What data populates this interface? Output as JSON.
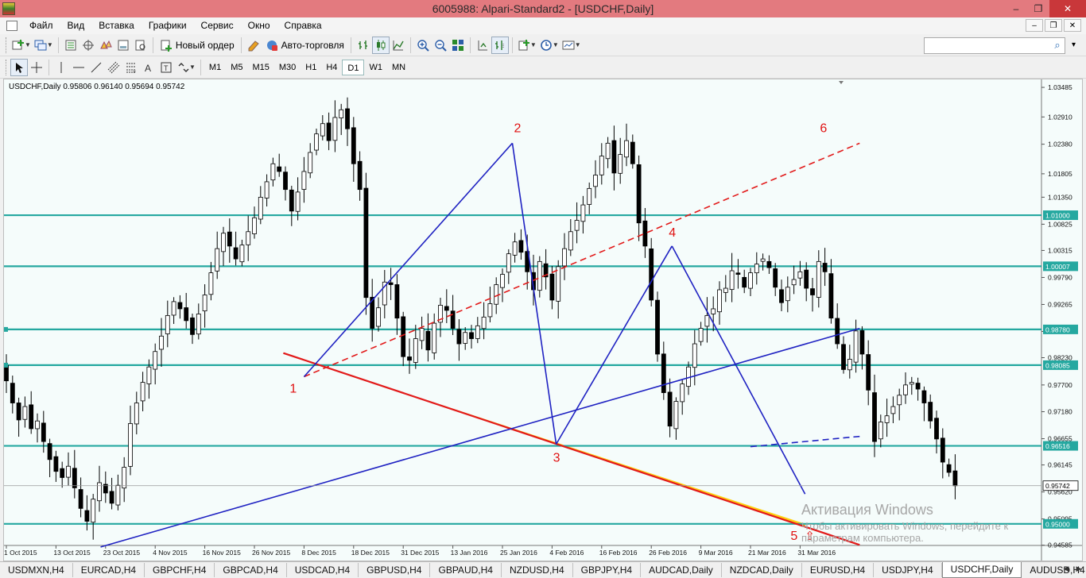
{
  "window": {
    "title": "6005988: Alpari-Standard2 - [USDCHF,Daily]",
    "buttons": {
      "minimize": "‒",
      "restore": "❐",
      "close": "✕"
    }
  },
  "menu": {
    "items": [
      "Файл",
      "Вид",
      "Вставка",
      "Графики",
      "Сервис",
      "Окно",
      "Справка"
    ],
    "mdi": {
      "minimize": "‒",
      "restore": "❐",
      "close": "✕"
    }
  },
  "toolbar1": {
    "new_order": "Новый ордер",
    "auto_trading": "Авто-торговля",
    "search": {
      "placeholder": "",
      "value": ""
    }
  },
  "toolbar2": {
    "timeframes": [
      "M1",
      "M5",
      "M15",
      "M30",
      "H1",
      "H4",
      "D1",
      "W1",
      "MN"
    ],
    "active_timeframe": "D1"
  },
  "chart": {
    "header": "USDCHF,Daily  0.95806 0.96140 0.95694 0.95742",
    "current_price_label": "0.95742",
    "colors": {
      "background": "#f5fcfb",
      "bull": "#ffffff",
      "bear": "#000000",
      "hline": "#25a8a0",
      "trend_blue": "#1f22c2",
      "trend_red": "#e21a1a",
      "fill_gold": "#ffcc00",
      "wave_label": "#e01010"
    },
    "wave_labels": [
      "1",
      "2",
      "3",
      "4",
      "5",
      "6"
    ],
    "arrow_glyph": "⇧"
  },
  "chart_data": {
    "type": "candlestick",
    "symbol": "USDCHF",
    "timeframe": "Daily",
    "ohlc_last": {
      "open": 0.95806,
      "high": 0.9614,
      "low": 0.95694,
      "close": 0.95742
    },
    "ylim": [
      0.9458,
      1.0364
    ],
    "y_ticks": [
      "1.03485",
      "1.02910",
      "1.02380",
      "1.01805",
      "1.01350",
      "1.00825",
      "1.00315",
      "0.99790",
      "0.99265",
      "0.98740",
      "0.98230",
      "0.97700",
      "0.97180",
      "0.96655",
      "0.96145",
      "0.95620",
      "0.95095",
      "0.94585"
    ],
    "x_ticks": [
      "1 Oct 2015",
      "13 Oct 2015",
      "23 Oct 2015",
      "4 Nov 2015",
      "16 Nov 2015",
      "26 Nov 2015",
      "8 Dec 2015",
      "18 Dec 2015",
      "31 Dec 2015",
      "13 Jan 2016",
      "25 Jan 2016",
      "4 Feb 2016",
      "16 Feb 2016",
      "26 Feb 2016",
      "9 Mar 2016",
      "21 Mar 2016",
      "31 Mar 2016"
    ],
    "horizontal_levels": [
      {
        "label": "1.01000",
        "value": 1.01
      },
      {
        "label": "1.00007",
        "value": 1.00007
      },
      {
        "label": "0.98780",
        "value": 0.9878
      },
      {
        "label": "0.98085",
        "value": 0.98085
      },
      {
        "label": "0.96516",
        "value": 0.96516
      },
      {
        "label": "0.95000",
        "value": 0.95
      }
    ],
    "closes": [
      0.9778,
      0.9735,
      0.9702,
      0.9728,
      0.9685,
      0.97,
      0.966,
      0.9625,
      0.9602,
      0.959,
      0.9612,
      0.957,
      0.953,
      0.9505,
      0.9548,
      0.958,
      0.956,
      0.954,
      0.9575,
      0.961,
      0.9695,
      0.9735,
      0.9775,
      0.9805,
      0.9835,
      0.9865,
      0.9905,
      0.9932,
      0.9918,
      0.9895,
      0.9868,
      0.9908,
      0.9945,
      0.9988,
      1.0035,
      1.0065,
      1.004,
      1.0015,
      1.0042,
      1.0068,
      1.0095,
      1.0135,
      1.0165,
      1.02,
      1.0185,
      1.015,
      1.0108,
      1.0145,
      1.0185,
      1.0222,
      1.0258,
      1.0278,
      1.0245,
      1.029,
      1.0305,
      1.0268,
      1.02,
      1.015,
      0.994,
      0.988,
      0.992,
      0.997,
      0.9965,
      0.99,
      0.9825,
      0.9818,
      0.986,
      0.988,
      0.9838,
      0.989,
      0.9925,
      0.9915,
      0.988,
      0.985,
      0.9872,
      0.986,
      0.9885,
      0.9902,
      0.9928,
      0.9965,
      0.9985,
      1.0025,
      1.0048,
      1.0028,
      0.999,
      0.9955,
      1.001,
      0.998,
      0.9935,
      1.0,
      1.0035,
      1.0068,
      1.009,
      1.012,
      1.0152,
      1.0178,
      1.0215,
      1.024,
      1.0182,
      1.0218,
      1.0245,
      1.02,
      1.0085,
      1.004,
      0.9935,
      0.983,
      0.9755,
      0.969,
      0.9738,
      0.9772,
      0.9805,
      0.985,
      0.988,
      0.9905,
      0.9918,
      0.9955,
      0.9958,
      0.9992,
      0.9985,
      0.996,
      0.9988,
      1.0005,
      1.0015,
      0.9998,
      0.996,
      0.993,
      0.996,
      0.9975,
      0.999,
      0.9958,
      0.9945,
      1.001,
      0.999,
      0.99,
      0.985,
      0.98,
      0.982,
      0.9875,
      0.983,
      0.976,
      0.966,
      0.9698,
      0.971,
      0.9728,
      0.975,
      0.977,
      0.9775,
      0.9762,
      0.9735,
      0.97,
      0.9665,
      0.962,
      0.96,
      0.9574
    ],
    "trendlines": [
      {
        "name": "support-red",
        "color": "#e21a1a",
        "from": [
          "3 Dec 2015",
          0.9832
        ],
        "to": [
          "12 Apr 2016",
          0.9459
        ]
      },
      {
        "name": "channel-red-dashed",
        "color": "#e21a1a",
        "dashed": true,
        "from": [
          "8 Dec 2015",
          0.9786
        ],
        "to": [
          "12 Apr 2016",
          1.024
        ]
      },
      {
        "name": "wave-1-2",
        "color": "#1f22c2",
        "from": [
          "8 Dec 2015",
          0.9786
        ],
        "to": [
          "27 Jan 2016",
          1.024
        ]
      },
      {
        "name": "wave-2-3",
        "color": "#1f22c2",
        "from": [
          "27 Jan 2016",
          1.024
        ],
        "to": [
          "5 Feb 2016",
          0.9655
        ]
      },
      {
        "name": "wave-3-4",
        "color": "#1f22c2",
        "from": [
          "5 Feb 2016",
          0.9655
        ],
        "to": [
          "2 Mar 2016",
          1.004
        ]
      },
      {
        "name": "wave-4-5",
        "color": "#1f22c2",
        "from": [
          "2 Mar 2016",
          1.004
        ],
        "to": [
          "1 Apr 2016",
          0.9558
        ]
      },
      {
        "name": "long-blue",
        "color": "#1f22c2",
        "from": [
          "22 Oct 2015",
          0.9455
        ],
        "to": [
          "12 Apr 2016",
          0.988
        ]
      },
      {
        "name": "blue-dashed",
        "color": "#1f22c2",
        "dashed": true,
        "from": [
          "21 Mar 2016",
          0.965
        ],
        "to": [
          "12 Apr 2016",
          0.967
        ]
      }
    ],
    "wave_points": [
      {
        "label": "1",
        "value": 0.9786
      },
      {
        "label": "2",
        "value": 1.024
      },
      {
        "label": "3",
        "value": 0.9655
      },
      {
        "label": "4",
        "value": 1.004
      },
      {
        "label": "5",
        "value": 0.9558
      },
      {
        "label": "6",
        "value": 1.024
      }
    ],
    "grid": false
  },
  "tabs": [
    {
      "label": "USDMXN,H4",
      "active": false
    },
    {
      "label": "EURCAD,H4",
      "active": false
    },
    {
      "label": "GBPCHF,H4",
      "active": false
    },
    {
      "label": "GBPCAD,H4",
      "active": false
    },
    {
      "label": "USDCAD,H4",
      "active": false
    },
    {
      "label": "GBPUSD,H4",
      "active": false
    },
    {
      "label": "GBPAUD,H4",
      "active": false
    },
    {
      "label": "NZDUSD,H4",
      "active": false
    },
    {
      "label": "GBPJPY,H4",
      "active": false
    },
    {
      "label": "AUDCAD,Daily",
      "active": false
    },
    {
      "label": "NZDCAD,Daily",
      "active": false
    },
    {
      "label": "EURUSD,H4",
      "active": false
    },
    {
      "label": "USDJPY,H4",
      "active": false
    },
    {
      "label": "USDCHF,Daily",
      "active": true
    },
    {
      "label": "AUDUSD,H4",
      "active": false
    }
  ],
  "watermark": {
    "line1": "Активация Windows",
    "line2": "Чтобы активировать Windows, перейдите к",
    "line3": "параметрам компьютера."
  }
}
